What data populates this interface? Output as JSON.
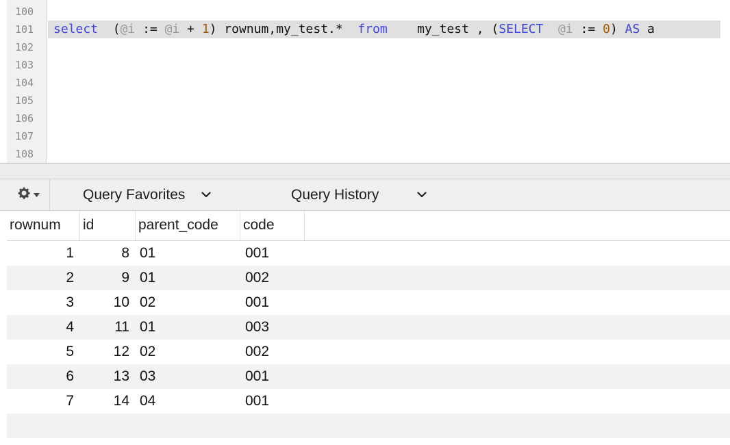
{
  "editor": {
    "line_numbers": [
      "100",
      "101",
      "102",
      "103",
      "104",
      "105",
      "106",
      "107",
      "108"
    ],
    "query": {
      "kw_select": "select",
      "open_paren": "(",
      "var_i_1": "@i",
      "assign_1": " := ",
      "var_i_2": "@i",
      "plus": " + ",
      "num_1": "1",
      "after_1": ") rownum,my_test.*  ",
      "kw_from": "from",
      "table_part": "    my_test , (",
      "kw_select_2": "SELECT",
      "var_i_3": "@i",
      "assign_2": " := ",
      "num_0": "0",
      "close_paren": ") ",
      "kw_as": "AS",
      "alias": " a"
    }
  },
  "toolbar": {
    "gear_icon": "gear-icon",
    "favorites_label": "Query Favorites",
    "history_label": "Query History"
  },
  "results": {
    "columns": [
      "rownum",
      "id",
      "parent_code",
      "code"
    ],
    "rows": [
      [
        "1",
        "8",
        "01",
        "001"
      ],
      [
        "2",
        "9",
        "01",
        "002"
      ],
      [
        "3",
        "10",
        "02",
        "001"
      ],
      [
        "4",
        "11",
        "01",
        "003"
      ],
      [
        "5",
        "12",
        "02",
        "002"
      ],
      [
        "6",
        "13",
        "03",
        "001"
      ],
      [
        "7",
        "14",
        "04",
        "001"
      ]
    ]
  }
}
